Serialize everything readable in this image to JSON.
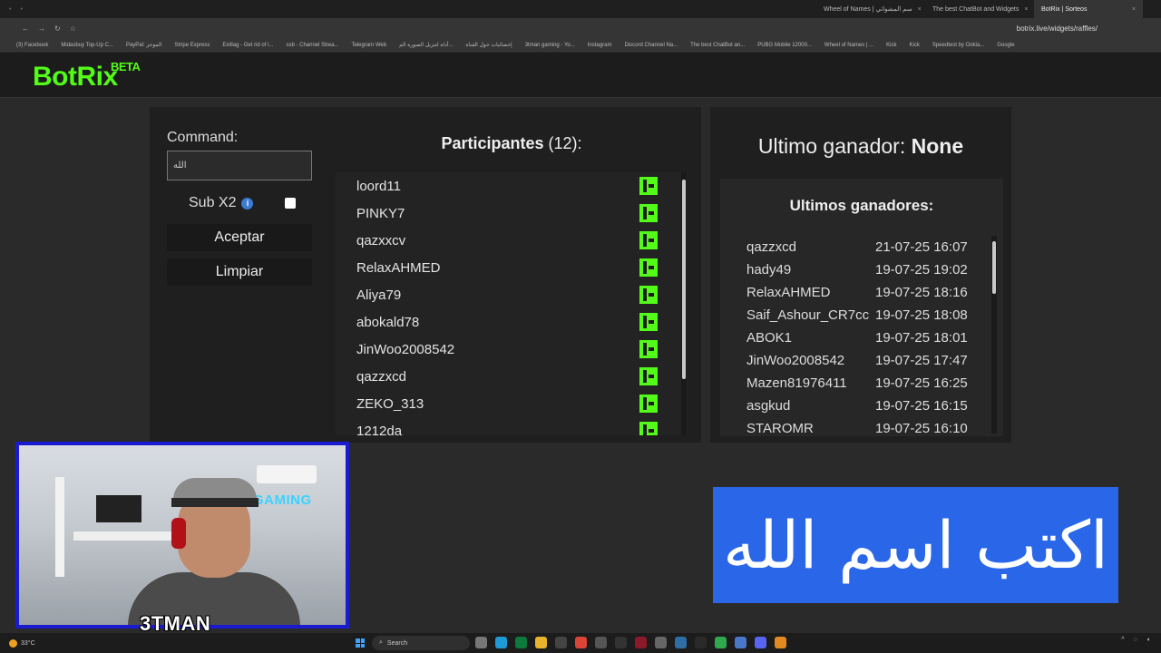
{
  "browser": {
    "tabs": [
      {
        "label": "Wheel of Names | سم المشواتي",
        "active": false
      },
      {
        "label": "The best ChatBot and Widgets",
        "active": false
      },
      {
        "label": "BotRix | Sorteos",
        "active": true
      }
    ],
    "url": "botrix.live/widgets/raffles/",
    "bookmarks": [
      "(3) Facebook",
      "Midasbuy Top-Up C...",
      "PayPal: الموجز",
      "Stripe Express",
      "Exitlag - Get rid of l...",
      "ssb - Channel Strea...",
      "Telegram Web",
      "أداة لتنزيل الصورة الم...",
      "إحصائيات حول القناة",
      "3tman gaming - Yo...",
      "Instagram",
      "Discord Channel Na...",
      "The best ChatBot an...",
      "PUBG Mobile 12000...",
      "Wheel of Names | ...",
      "Kick",
      "Kick",
      "Speedtest by Ookla...",
      "Google"
    ]
  },
  "app": {
    "logo": "BotRix",
    "logo_badge": "BETA"
  },
  "raffle": {
    "command_label": "Command:",
    "command_value": "الله",
    "sub_x2_label": "Sub X2",
    "sub_x2_checked": false,
    "accept_label": "Aceptar",
    "clear_label": "Limpiar"
  },
  "participants": {
    "title": "Participantes",
    "count": "(12):",
    "items": [
      "loord11",
      "PINKY7",
      "qazxxcv",
      "RelaxAHMED",
      "Aliya79",
      "abokald78",
      "JinWoo2008542",
      "qazzxcd",
      "ZEKO_313",
      "1212da"
    ]
  },
  "last_winner": {
    "label": "Ultimo ganador:",
    "value": "None"
  },
  "winners": {
    "title": "Ultimos ganadores:",
    "items": [
      {
        "name": "qazzxcd",
        "date": "21-07-25 16:07"
      },
      {
        "name": "hady49",
        "date": "19-07-25 19:02"
      },
      {
        "name": "RelaxAHMED",
        "date": "19-07-25 18:16"
      },
      {
        "name": "Saif_Ashour_CR7cc",
        "date": "19-07-25 18:08"
      },
      {
        "name": "ABOK1",
        "date": "19-07-25 18:01"
      },
      {
        "name": "JinWoo2008542",
        "date": "19-07-25 17:47"
      },
      {
        "name": "Mazen81976411",
        "date": "19-07-25 16:25"
      },
      {
        "name": "asgkud",
        "date": "19-07-25 16:15"
      },
      {
        "name": "STAROMR",
        "date": "19-07-25 16:10"
      }
    ]
  },
  "overlay": {
    "cam_name": "3TMAN",
    "cam_neon": "GAMING",
    "arabic_text": "اكتب اسم الله"
  },
  "taskbar": {
    "weather": "33°C",
    "search_placeholder": "Search"
  },
  "colors": {
    "accent": "#53fc18",
    "arabic_bg": "#2a66e8",
    "cam_border": "#1a1ad0"
  }
}
